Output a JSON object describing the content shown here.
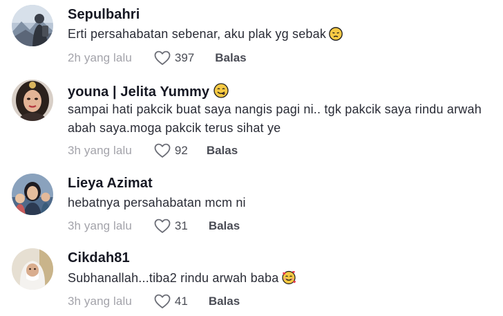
{
  "comments": [
    {
      "author": "Sepulbahri",
      "text": "Erti persahabatan sebenar, aku plak yg sebak",
      "text_emoji_icon": "pensive-face-emoji",
      "time": "2h yang lalu",
      "likes": "397",
      "reply_label": "Balas"
    },
    {
      "author": "youna | Jelita Yummy",
      "author_emoji_icon": "savoring-food-face-emoji",
      "text": "sampai hati pakcik buat saya nangis pagi ni.. tgk pakcik saya rindu arwah abah saya.moga pakcik terus sihat ye",
      "time": "3h yang lalu",
      "likes": "92",
      "reply_label": "Balas"
    },
    {
      "author": "Lieya Azimat",
      "text": "hebatnya persahabatan mcm ni",
      "time": "3h yang lalu",
      "likes": "31",
      "reply_label": "Balas"
    },
    {
      "author": "Cikdah81",
      "text": "Subhanallah...tiba2 rindu arwah baba",
      "text_emoji_icon": "smiling-face-with-hearts-emoji",
      "time": "3h yang lalu",
      "likes": "41",
      "reply_label": "Balas"
    }
  ]
}
